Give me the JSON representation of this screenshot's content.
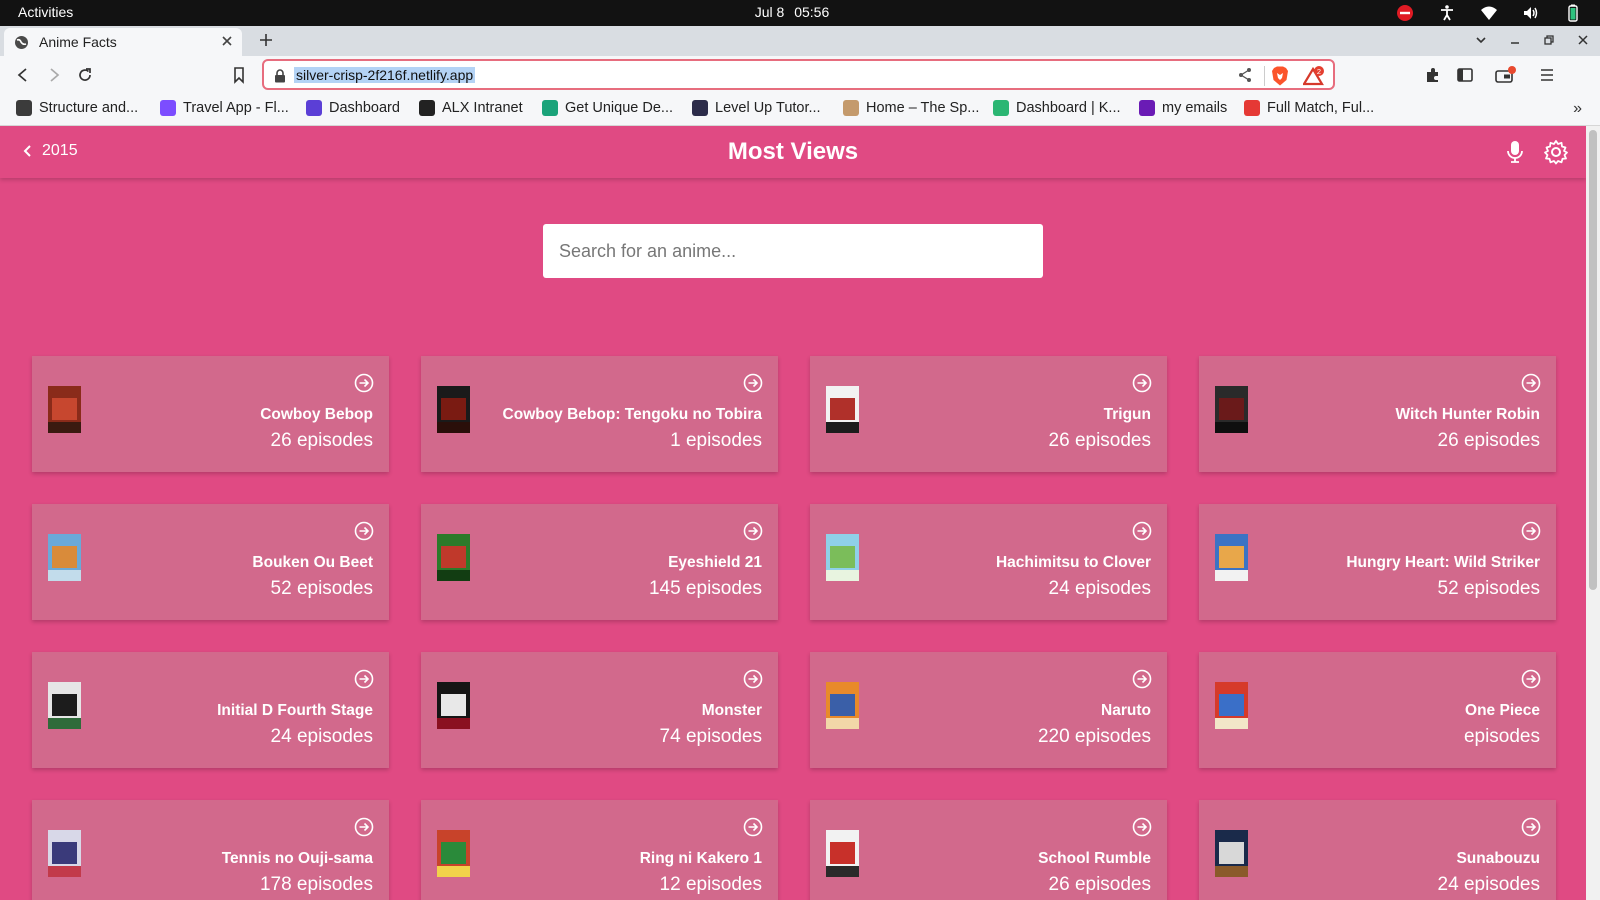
{
  "system": {
    "activities": "Activities",
    "date": "Jul 8",
    "time": "05:56"
  },
  "browser": {
    "tab_title": "Anime Facts",
    "url": "silver-crisp-2f216f.netlify.app",
    "rewards_badge": "2",
    "bookmarks": [
      {
        "label": "Structure and...",
        "color": "#3b3b3b"
      },
      {
        "label": "Travel App - Fl...",
        "color": "#7c4dff"
      },
      {
        "label": "Dashboard",
        "color": "#5b3fd6"
      },
      {
        "label": "ALX Intranet",
        "color": "#222222"
      },
      {
        "label": "Get Unique De...",
        "color": "#1aa37a"
      },
      {
        "label": "Level Up Tutor...",
        "color": "#2c2c4a"
      },
      {
        "label": "Home – The Sp...",
        "color": "#c49a6c"
      },
      {
        "label": "Dashboard | K...",
        "color": "#2bb673"
      },
      {
        "label": "my emails",
        "color": "#6a1bb5"
      },
      {
        "label": "Full Match, Ful...",
        "color": "#e53935"
      }
    ],
    "more_bookmarks": "»"
  },
  "app": {
    "back_label": "2015",
    "title": "Most Views",
    "search_placeholder": "Search for an anime...",
    "accent_color": "#e04a83",
    "card_color": "#d2698c",
    "cards": [
      {
        "name": "Cowboy Bebop",
        "episodes": "26 episodes",
        "thumb": [
          "#8a2b1a",
          "#c7472f",
          "#3a1a10"
        ]
      },
      {
        "name": "Cowboy Bebop: Tengoku no Tobira",
        "episodes": "1 episodes",
        "thumb": [
          "#1a1a1a",
          "#7a1b12",
          "#2a0f0a"
        ]
      },
      {
        "name": "Trigun",
        "episodes": "26 episodes",
        "thumb": [
          "#f2f2f2",
          "#b0302a",
          "#1c1c1c"
        ]
      },
      {
        "name": "Witch Hunter Robin",
        "episodes": "26 episodes",
        "thumb": [
          "#2a2a2a",
          "#6a1a1a",
          "#0f0f0f"
        ]
      },
      {
        "name": "Bouken Ou Beet",
        "episodes": "52 episodes",
        "thumb": [
          "#6aa9d8",
          "#d98b3a",
          "#c2dceb"
        ]
      },
      {
        "name": "Eyeshield 21",
        "episodes": "145 episodes",
        "thumb": [
          "#2c7a2a",
          "#c0392b",
          "#123d12"
        ]
      },
      {
        "name": "Hachimitsu to Clover",
        "episodes": "24 episodes",
        "thumb": [
          "#8fd0e8",
          "#7bbd5a",
          "#e8f4e0"
        ]
      },
      {
        "name": "Hungry Heart: Wild Striker",
        "episodes": "52 episodes",
        "thumb": [
          "#3b73c4",
          "#e8a74a",
          "#f2f2f2"
        ]
      },
      {
        "name": "Initial D Fourth Stage",
        "episodes": "24 episodes",
        "thumb": [
          "#e6e6e6",
          "#1c1c1c",
          "#2f6b3a"
        ]
      },
      {
        "name": "Monster",
        "episodes": "74 episodes",
        "thumb": [
          "#151515",
          "#e8e8e8",
          "#8a1020"
        ]
      },
      {
        "name": "Naruto",
        "episodes": "220 episodes",
        "thumb": [
          "#e88a2a",
          "#3a5fa8",
          "#f2d7a8"
        ]
      },
      {
        "name": "One Piece",
        "episodes": "episodes",
        "thumb": [
          "#d63a2a",
          "#3a6fc8",
          "#f2e6c8"
        ]
      },
      {
        "name": "Tennis no Ouji-sama",
        "episodes": "178 episodes",
        "thumb": [
          "#d8d8e8",
          "#3a3a7a",
          "#c23a4a"
        ]
      },
      {
        "name": "Ring ni Kakero 1",
        "episodes": "12 episodes",
        "thumb": [
          "#c8432a",
          "#2a8a3a",
          "#f2d24a"
        ]
      },
      {
        "name": "School Rumble",
        "episodes": "26 episodes",
        "thumb": [
          "#f2f2f2",
          "#c8302a",
          "#2a2a2a"
        ]
      },
      {
        "name": "Sunabouzu",
        "episodes": "24 episodes",
        "thumb": [
          "#1a2a4a",
          "#d8d8d8",
          "#8a5a2a"
        ]
      }
    ]
  }
}
